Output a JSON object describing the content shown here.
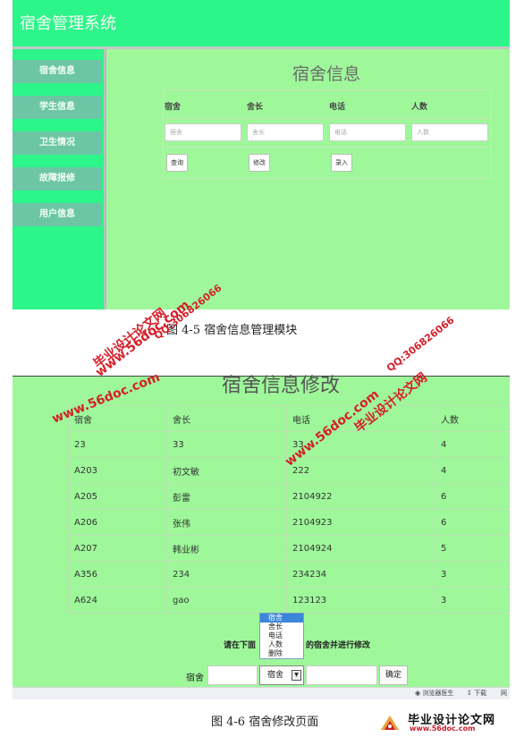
{
  "figure1": {
    "app_title": "宿舍管理系统",
    "nav": [
      "宿舍信息",
      "学生信息",
      "卫生情况",
      "故障报修",
      "用户信息"
    ],
    "panel_title": "宿舍信息",
    "columns": [
      "宿舍",
      "舍长",
      "电话",
      "人数"
    ],
    "placeholders": [
      "宿舍",
      "舍长",
      "电话",
      "人数"
    ],
    "buttons": [
      "查询",
      "修改",
      "录入"
    ],
    "caption": "图 4-5 宿舍信息管理模块"
  },
  "figure2": {
    "title": "宿舍信息修改",
    "table_header": [
      "宿舍",
      "舍长",
      "电话",
      "人数"
    ],
    "rows": [
      [
        "23",
        "33",
        "33",
        "4"
      ],
      [
        "A203",
        "初文敏",
        "222",
        "4"
      ],
      [
        "A205",
        "彭雷",
        "2104922",
        "6"
      ],
      [
        "A206",
        "张伟",
        "2104923",
        "6"
      ],
      [
        "A207",
        "韩业彬",
        "2104924",
        "5"
      ],
      [
        "A356",
        "234",
        "234234",
        "3"
      ],
      [
        "A624",
        "gao",
        "123123",
        "3"
      ]
    ],
    "prompt_left": "请在下面",
    "prompt_right": "的宿舍并进行修改",
    "dropdown_options": [
      "宿舍",
      "舍长",
      "电话",
      "人数",
      "删除"
    ],
    "dropdown_selected": "宿舍",
    "field_label": "宿舍",
    "confirm": "确定",
    "status_items": [
      "浏览器医生",
      "下载",
      "网"
    ],
    "caption": "图 4-6 宿舍修改页面"
  },
  "watermarks": {
    "site_cn": "毕业设计论文网",
    "url": "www.56doc.com",
    "qq": "QQ:306826066"
  },
  "footer_logo": {
    "name": "毕业设计论文网",
    "url": "www.56doc.com"
  },
  "colors": {
    "page_green": "#9ef89a",
    "header_green": "#2cf58a",
    "nav_item": "#6cc6a6",
    "watermark_red": "#d4202a"
  }
}
